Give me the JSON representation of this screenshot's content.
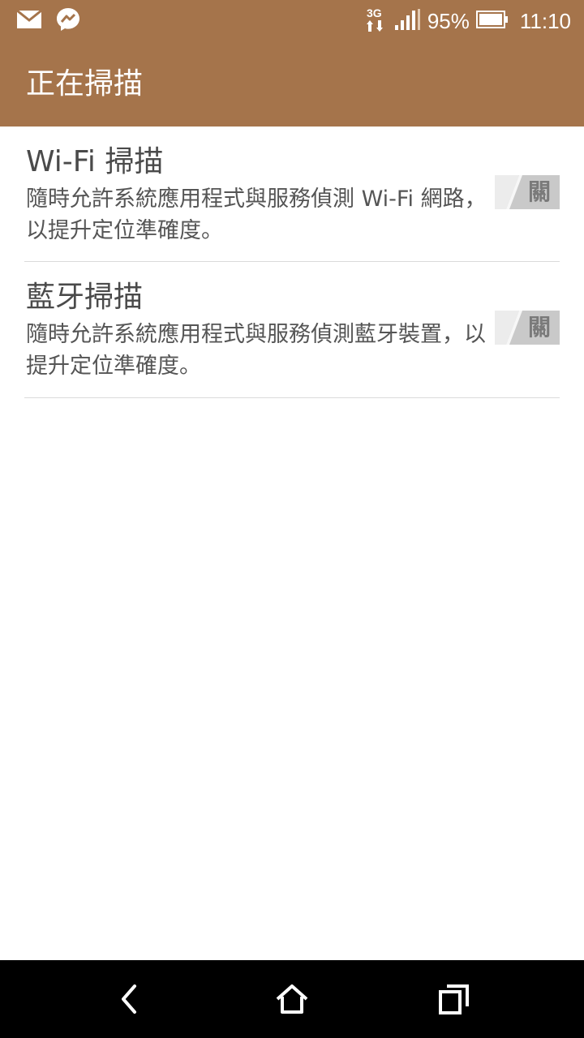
{
  "status_bar": {
    "battery_percent": "95%",
    "time": "11:10",
    "network_type": "3G",
    "icons": [
      "mail-icon",
      "messenger-icon",
      "network-3g-icon",
      "signal-icon",
      "battery-icon"
    ]
  },
  "app_bar": {
    "title": "正在掃描"
  },
  "settings": {
    "items": [
      {
        "title": "Wi-Fi 掃描",
        "summary": "隨時允許系統應用程式與服務偵測 Wi-Fi 網路，以提升定位準確度。",
        "toggle_label": "關"
      },
      {
        "title": "藍牙掃描",
        "summary": "隨時允許系統應用程式與服務偵測藍牙裝置，以提升定位準確度。",
        "toggle_label": "關"
      }
    ]
  },
  "nav_bar": {
    "icons": [
      "back-icon",
      "home-icon",
      "recent-apps-icon"
    ]
  },
  "colors": {
    "app_bar": "#A5744B",
    "background": "#FFFFFF",
    "nav_bar": "#000000",
    "toggle_off": "#C9C9C9",
    "divider": "#DADADA"
  }
}
